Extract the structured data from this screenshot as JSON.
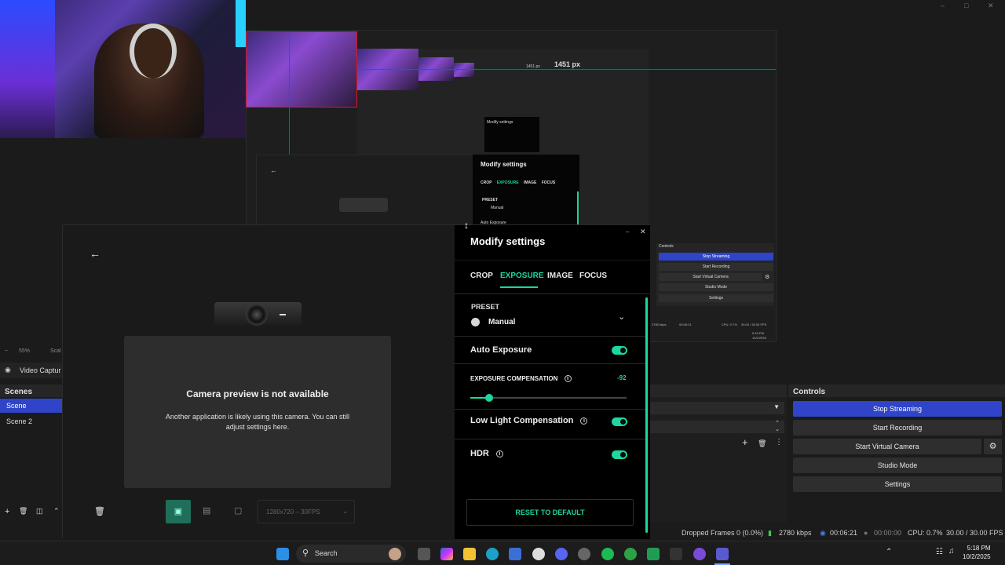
{
  "window_controls": {
    "minimize": "–",
    "maximize": "□",
    "close": "✕"
  },
  "nested_preview": {
    "px_label_large": "1451 px",
    "px_label_small": "1451 px",
    "modify_settings_mid": "Modify settings",
    "modify_settings_small": "Modify settings",
    "mid_tabs": [
      "CROP",
      "EXPOSURE",
      "IMAGE",
      "FOCUS"
    ],
    "mid_preset_label": "PRESET",
    "mid_preset_value": "Manual",
    "mid_auto_exposure": "Auto Exposure",
    "mini_controls_title": "Controls",
    "mini_buttons": [
      "Stop Streaming",
      "Start Recording",
      "Start Virtual Camera",
      "Studio Mode",
      "Settings"
    ],
    "mini_status_kbps": "2780 kbps",
    "mini_status_time": "00:06:21",
    "mini_status_cpu": "CPU: 0.7%",
    "mini_status_fps": "30.00 / 30.00 FPS",
    "mini_clock": "5:18 PM",
    "mini_date": "10/2/2025"
  },
  "obs": {
    "zoom": "55%",
    "scale_label": "Scal",
    "source_name": "Video Captur",
    "scenes_title": "Scenes",
    "scenes": [
      "Scene",
      "Scene 2"
    ],
    "controls_title": "Controls",
    "controls": {
      "stop_streaming": "Stop Streaming",
      "start_recording": "Start Recording",
      "start_virtual_camera": "Start Virtual Camera",
      "studio_mode": "Studio Mode",
      "settings": "Settings"
    },
    "status": {
      "dropped": "Dropped Frames 0 (0.0%)",
      "kbps": "2780 kbps",
      "stream_time": "00:06:21",
      "rec_time": "00:00:00",
      "cpu": "CPU: 0.7%",
      "fps": "30.00 / 30.00 FPS"
    },
    "accent_color": "#2f44c9"
  },
  "logi": {
    "camera_unavailable_title": "Camera preview is not available",
    "camera_unavailable_body": "Another application is likely using this camera. You can still adjust settings here.",
    "resolution_select": "1280x720 – 30FPS",
    "panel_title": "Modify settings",
    "tabs": [
      "CROP",
      "EXPOSURE",
      "IMAGE",
      "FOCUS"
    ],
    "active_tab": "EXPOSURE",
    "preset_label": "PRESET",
    "preset_value": "Manual",
    "auto_exposure_label": "Auto Exposure",
    "auto_exposure_on": true,
    "exposure_comp_label": "EXPOSURE COMPENSATION",
    "exposure_comp_value": "-92",
    "exposure_comp_fraction": 0.12,
    "low_light_label": "Low Light Compensation",
    "low_light_on": true,
    "hdr_label": "HDR",
    "hdr_on": true,
    "reset_label": "RESET TO DEFAULT",
    "accent_color": "#1ed6a0"
  },
  "taskbar": {
    "search_label": "Search",
    "clock_time": "5:18 PM",
    "clock_date": "10/2/2025"
  }
}
